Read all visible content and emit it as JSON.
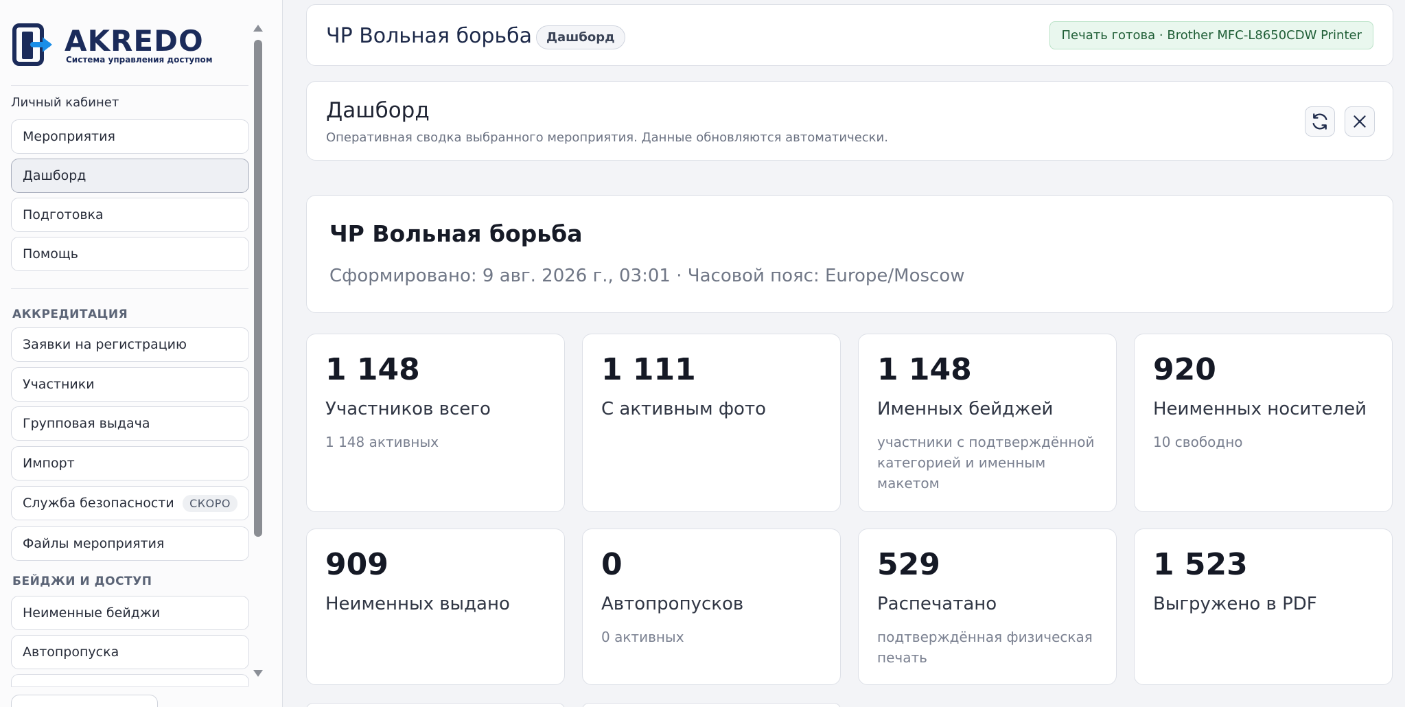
{
  "brand": {
    "name": "AKREDO",
    "tagline": "Система управления доступом",
    "colors": {
      "navy": "#1b2b5a",
      "accent": "#1a8ee8"
    }
  },
  "sidebar": {
    "personal_label": "Личный кабинет",
    "personal_items": [
      {
        "label": "Мероприятия",
        "active": false
      },
      {
        "label": "Дашборд",
        "active": true
      },
      {
        "label": "Подготовка",
        "active": false
      },
      {
        "label": "Помощь",
        "active": false
      }
    ],
    "sections": [
      {
        "title": "АККРЕДИТАЦИЯ",
        "items": [
          {
            "label": "Заявки на регистрацию"
          },
          {
            "label": "Участники"
          },
          {
            "label": "Групповая выдача"
          },
          {
            "label": "Импорт"
          },
          {
            "label": "Служба безопасности",
            "badge": "СКОРО"
          },
          {
            "label": "Файлы мероприятия"
          }
        ]
      },
      {
        "title": "БЕЙДЖИ И ДОСТУП",
        "items": [
          {
            "label": "Неименные бейджи"
          },
          {
            "label": "Автопропуска"
          }
        ]
      }
    ]
  },
  "topbar": {
    "event_name": "ЧР Вольная борьба",
    "view_pill": "Дашборд",
    "printer_status": "Печать готова · Brother MFC-L8650CDW Printer",
    "status_color": "#1f5e36"
  },
  "header": {
    "title": "Дашборд",
    "subtitle": "Оперативная сводка выбранного мероприятия. Данные обновляются автоматически.",
    "refresh_icon": "refresh-icon",
    "close_icon": "close-icon"
  },
  "event_card": {
    "title": "ЧР Вольная борьба",
    "meta": "Сформировано: 9 авг. 2026 г., 03:01 · Часовой пояс: Europe/Moscow"
  },
  "stats": [
    {
      "value": "1 148",
      "label": "Участников всего",
      "note": "1 148 активных"
    },
    {
      "value": "1 111",
      "label": "С активным фото",
      "note": ""
    },
    {
      "value": "1 148",
      "label": "Именных бейджей",
      "note": "участники с подтверждённой категорией и именным макетом"
    },
    {
      "value": "920",
      "label": "Неименных носителей",
      "note": "10 свободно"
    },
    {
      "value": "909",
      "label": "Неименных выдано",
      "note": ""
    },
    {
      "value": "0",
      "label": "Автопропусков",
      "note": "0 активных"
    },
    {
      "value": "529",
      "label": "Распечатано",
      "note": "подтверждённая физическая печать"
    },
    {
      "value": "1 523",
      "label": "Выгружено в PDF",
      "note": ""
    }
  ]
}
